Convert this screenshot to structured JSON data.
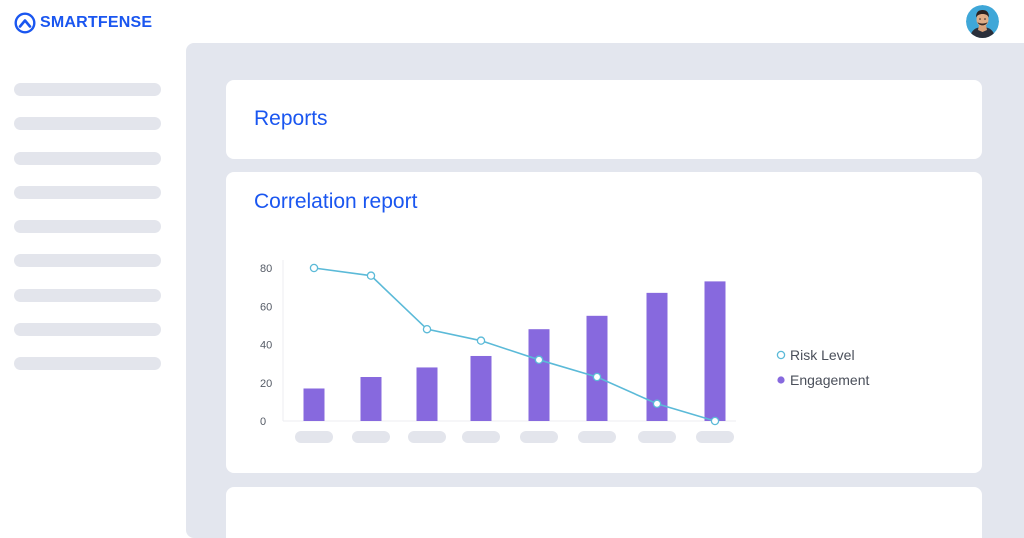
{
  "brand": {
    "name": "SMARTFENSE",
    "color": "#1a56f0"
  },
  "header": {
    "avatar_icon": "user-avatar"
  },
  "sidebar": {
    "item_count": 9
  },
  "reports_card": {
    "title": "Reports"
  },
  "correlation_card": {
    "title": "Correlation report"
  },
  "chart_data": {
    "type": "bar",
    "title": "Correlation report",
    "xlabel": "",
    "ylabel": "",
    "ylim": [
      0,
      80
    ],
    "y_ticks": [
      0,
      20,
      40,
      60,
      80
    ],
    "categories": [
      "",
      "",
      "",
      "",
      "",
      "",
      "",
      ""
    ],
    "series": [
      {
        "name": "Engagement",
        "type": "bar",
        "color": "#8769de",
        "values": [
          17,
          23,
          28,
          34,
          48,
          55,
          67,
          73
        ]
      },
      {
        "name": "Risk Level",
        "type": "line",
        "color": "#5bbad8",
        "values": [
          80,
          76,
          48,
          42,
          32,
          23,
          9,
          0
        ]
      }
    ],
    "legend_position": "right",
    "grid": false
  }
}
